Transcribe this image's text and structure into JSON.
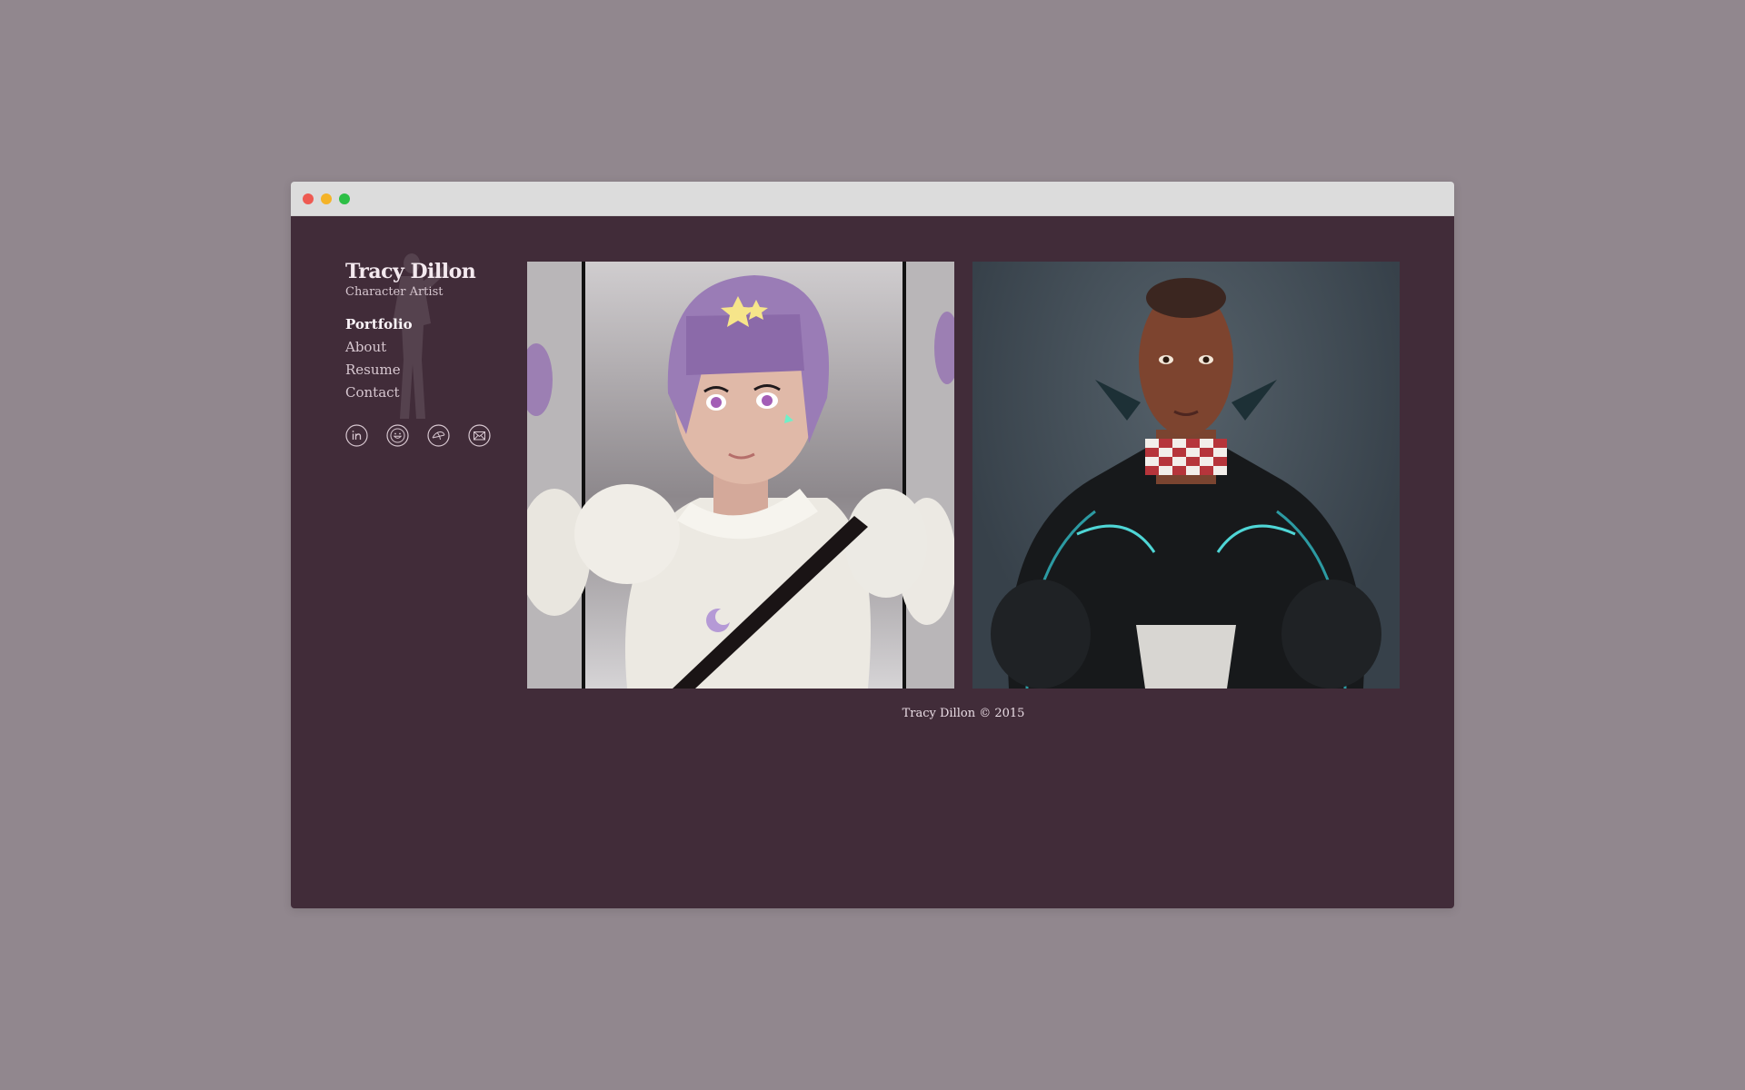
{
  "brand": {
    "name": "Tracy Dillon",
    "tagline": "Character Artist"
  },
  "nav": {
    "items": [
      {
        "label": "Portfolio",
        "active": true
      },
      {
        "label": "About",
        "active": false
      },
      {
        "label": "Resume",
        "active": false
      },
      {
        "label": "Contact",
        "active": false
      }
    ]
  },
  "social": {
    "icons": [
      "linkedin-icon",
      "smiley-icon",
      "dribbble-icon",
      "mail-icon"
    ]
  },
  "footer": {
    "copyright": "Tracy Dillon © 2015"
  },
  "colors": {
    "page_background": "#91878e",
    "site_background": "#412c39",
    "text": "#eadde5"
  }
}
